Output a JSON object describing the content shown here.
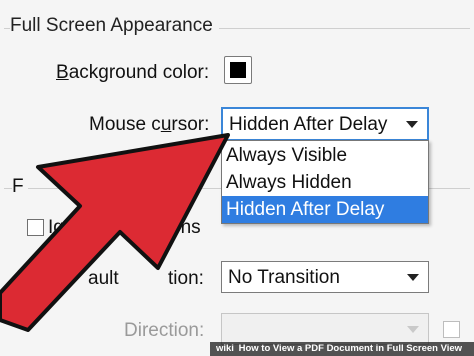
{
  "group": {
    "title": "Full Screen Appearance"
  },
  "background_color": {
    "label_pre": "",
    "label_underline": "B",
    "label_post": "ackground color:",
    "swatch_color": "#000000"
  },
  "mouse_cursor": {
    "label_pre": "Mouse c",
    "label_underline": "u",
    "label_post": "rsor:",
    "selected": "Hidden After Delay",
    "options": [
      "Always Visible",
      "Always Hidden",
      "Hidden After Delay"
    ]
  },
  "partial": {
    "section_letter": "F",
    "ignore_checkbox_pre": "Ig",
    "ignore_checkbox_post": "ons",
    "default_transition_fragment": "ault",
    "transition_fragment": "tion:",
    "transition_value": "No Transition",
    "direction_label": "Direction:"
  },
  "watermark": {
    "brand": "wiki",
    "text": "How to View a PDF Document in Full Screen View"
  },
  "colors": {
    "arrow": "#dc2a33",
    "highlight": "#2f7de1",
    "focus": "#3a86d8"
  }
}
